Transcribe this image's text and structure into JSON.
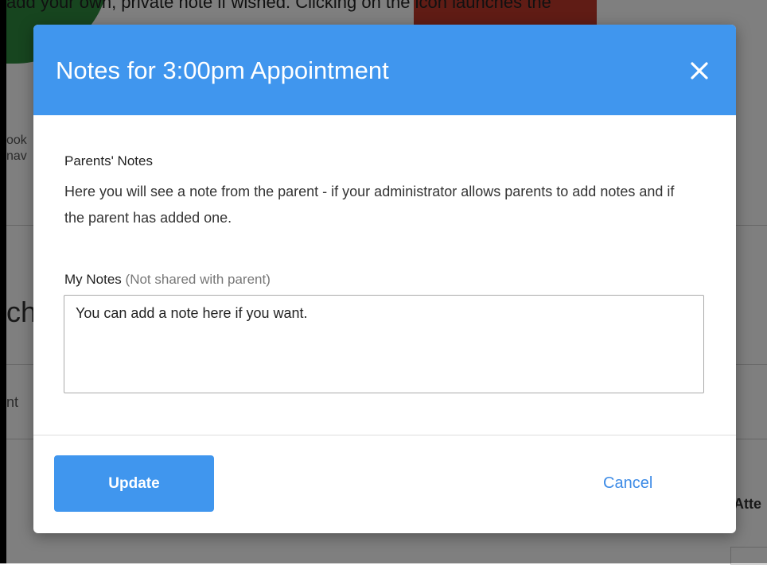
{
  "background": {
    "top_text": "add your own, private note if wished. Clicking on the icon launches the",
    "frag_book": "ook",
    "frag_nav": "nav",
    "frag_sche": "che",
    "frag_nt": "nt",
    "frag_atte": "Atte"
  },
  "modal": {
    "title": "Notes for 3:00pm Appointment",
    "close_icon": "close-icon",
    "parents_notes": {
      "label": "Parents' Notes",
      "text": "Here you will see a note from the parent - if your administrator allows parents to add notes and if the parent has added one."
    },
    "my_notes": {
      "label": "My Notes",
      "hint": "(Not shared with parent)",
      "value": "You can add a note here if you want."
    },
    "update_label": "Update",
    "cancel_label": "Cancel"
  },
  "colors": {
    "header": "#4096ee",
    "primary_button": "#4096ee",
    "link": "#3d8be6"
  }
}
